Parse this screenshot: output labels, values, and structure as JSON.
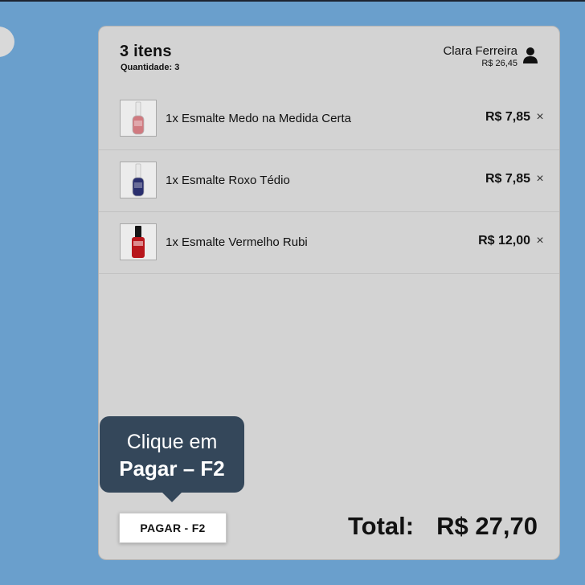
{
  "cart": {
    "items_count_label": "3 itens",
    "quantity_label": "Quantidade: 3",
    "user": {
      "name": "Clara Ferreira",
      "amount": "R$ 26,45",
      "icon": "user-icon"
    },
    "items": [
      {
        "name": "1x Esmalte Medo na Medida Certa",
        "price": "R$ 7,85",
        "remove": "×",
        "bottle_color": "#d07a80",
        "icon": "nail-polish-thumbnail"
      },
      {
        "name": "1x Esmalte Roxo Tédio",
        "price": "R$ 7,85",
        "remove": "×",
        "bottle_color": "#2a2f6e",
        "icon": "nail-polish-thumbnail"
      },
      {
        "name": "1x Esmalte Vermelho Rubi",
        "price": "R$ 12,00",
        "remove": "×",
        "bottle_color": "#b8161c",
        "icon": "nail-polish-thumbnail"
      }
    ],
    "pay_button_label": "PAGAR - F2",
    "total_label": "Total:",
    "total_value": "R$ 27,70"
  },
  "tooltip": {
    "line1": "Clique em",
    "line2": "Pagar – F2"
  }
}
